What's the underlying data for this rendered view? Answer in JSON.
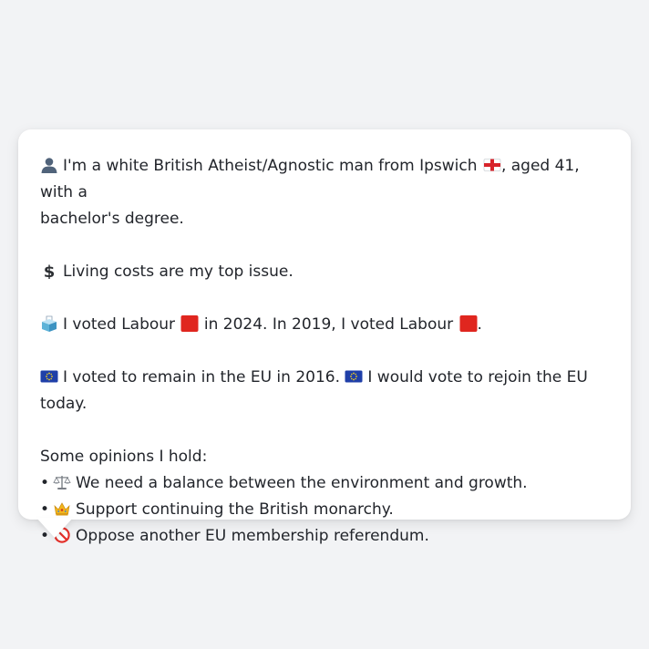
{
  "profile": {
    "line1_text": "I'm a white British Atheist/Agnostic man from Ipswich",
    "line1_tail": ", aged 41, with a",
    "line1_cont": "bachelor's degree.",
    "issue_text": "Living costs are my top issue.",
    "vote_a": "I voted Labour",
    "vote_b": "in 2024. In 2019, I voted Labour",
    "vote_c": ".",
    "eu_a": "I voted to remain in the EU in 2016.",
    "eu_b": "I would vote to rejoin the EU today.",
    "opinions_heading": "Some opinions I hold:",
    "opinions": [
      {
        "bullet": "•",
        "icon": "balance-scale-icon",
        "text": "We need a balance between the environment and growth."
      },
      {
        "bullet": "•",
        "icon": "crown-icon",
        "text": "Support continuing the British monarchy."
      },
      {
        "bullet": "•",
        "icon": "no-entry-icon",
        "text": "Oppose another EU membership referendum."
      }
    ]
  },
  "icons": {
    "person": "person-silhouette-icon",
    "flag": "england-flag-icon",
    "dollar": "dollar-sign-icon",
    "ballot": "ballot-box-icon",
    "party": "labour-red-square-icon",
    "eu": "eu-flag-icon"
  },
  "colors": {
    "background": "#f2f3f5",
    "card": "#ffffff",
    "text": "#22252b",
    "labour_red": "#e0261f",
    "eu_blue": "#1f3fa8",
    "eu_star": "#f6d21c"
  }
}
